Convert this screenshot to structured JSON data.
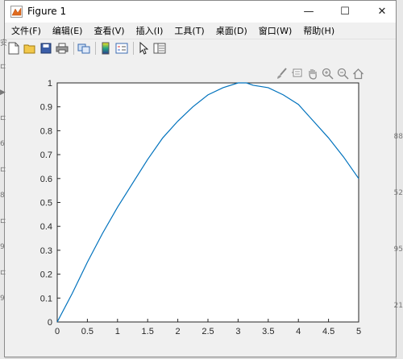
{
  "window": {
    "title": "Figure 1",
    "icon": "matlab-icon",
    "controls": {
      "minimize": "—",
      "maximize": "☐",
      "close": "✕"
    }
  },
  "menu": [
    "文件(F)",
    "编辑(E)",
    "查看(V)",
    "插入(I)",
    "工具(T)",
    "桌面(D)",
    "窗口(W)",
    "帮助(H)"
  ],
  "toolbar": [
    "new-figure-icon",
    "open-icon",
    "save-icon",
    "print-icon",
    "link-icon",
    "colorbar-icon",
    "legend-icon",
    "pointer-icon",
    "property-inspector-icon"
  ],
  "axes_toolbar": [
    "brush-icon",
    "data-tips-icon",
    "pan-icon",
    "zoom-in-icon",
    "zoom-out-icon",
    "home-icon"
  ],
  "chart_data": {
    "type": "line",
    "title": "",
    "xlabel": "",
    "ylabel": "",
    "xlim": [
      0,
      5
    ],
    "ylim": [
      0,
      1
    ],
    "xticks": [
      "0",
      "0.5",
      "1",
      "1.5",
      "2",
      "2.5",
      "3",
      "3.5",
      "4",
      "4.5",
      "5"
    ],
    "yticks": [
      "0",
      "0.1",
      "0.2",
      "0.3",
      "0.4",
      "0.5",
      "0.6",
      "0.7",
      "0.8",
      "0.9",
      "1"
    ],
    "grid": false,
    "series": [
      {
        "color": "#0072bd",
        "x": [
          0,
          0.25,
          0.5,
          0.75,
          1.0,
          1.25,
          1.5,
          1.75,
          2.0,
          2.25,
          2.5,
          2.75,
          3.0,
          3.14,
          3.25,
          3.5,
          3.75,
          4.0,
          4.25,
          4.5,
          4.75,
          5.0
        ],
        "y": [
          0,
          0.12,
          0.25,
          0.37,
          0.48,
          0.58,
          0.68,
          0.77,
          0.84,
          0.9,
          0.95,
          0.98,
          1.0,
          1.0,
          0.99,
          0.98,
          0.95,
          0.91,
          0.84,
          0.77,
          0.69,
          0.6
        ]
      }
    ]
  },
  "background_marks": {
    "left": [
      "安",
      "⊏",
      "▶",
      "⊏",
      "6",
      "⊏",
      "8",
      "⊏",
      "9",
      "⊏",
      "9"
    ],
    "right": [
      "",
      "88",
      "",
      "52",
      "",
      "95",
      "",
      "21"
    ]
  }
}
